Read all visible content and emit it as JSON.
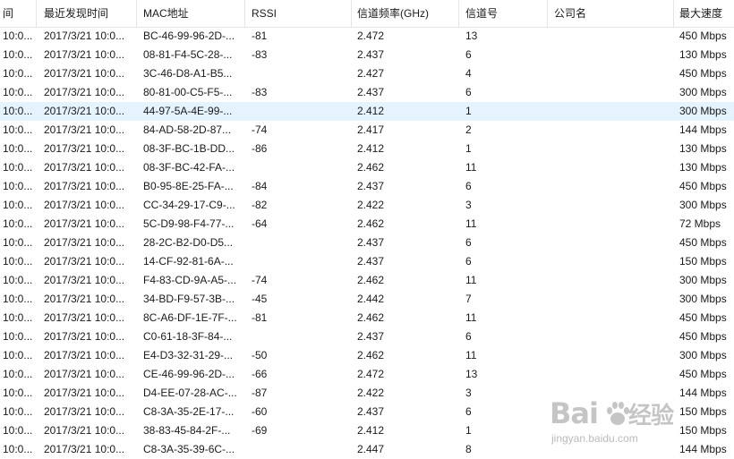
{
  "columns": [
    "间",
    "最近发现时间",
    "MAC地址",
    "RSSI",
    "信道频率(GHz)",
    "信道号",
    "公司名",
    "最大速度"
  ],
  "selected_row": 4,
  "rows": [
    [
      "10:0...",
      "2017/3/21 10:0...",
      "BC-46-99-96-2D-...",
      "-81",
      "2.472",
      "13",
      "",
      "450 Mbps"
    ],
    [
      "10:0...",
      "2017/3/21 10:0...",
      "08-81-F4-5C-28-...",
      "-83",
      "2.437",
      "6",
      "",
      "130 Mbps"
    ],
    [
      "10:0...",
      "2017/3/21 10:0...",
      "3C-46-D8-A1-B5...",
      "",
      "2.427",
      "4",
      "",
      "450 Mbps"
    ],
    [
      "10:0...",
      "2017/3/21 10:0...",
      "80-81-00-C5-F5-...",
      "-83",
      "2.437",
      "6",
      "",
      "300 Mbps"
    ],
    [
      "10:0...",
      "2017/3/21 10:0...",
      "44-97-5A-4E-99-...",
      "",
      "2.412",
      "1",
      "",
      "300 Mbps"
    ],
    [
      "10:0...",
      "2017/3/21 10:0...",
      "84-AD-58-2D-87...",
      "-74",
      "2.417",
      "2",
      "",
      "144 Mbps"
    ],
    [
      "10:0...",
      "2017/3/21 10:0...",
      "08-3F-BC-1B-DD...",
      "-86",
      "2.412",
      "1",
      "",
      "130 Mbps"
    ],
    [
      "10:0...",
      "2017/3/21 10:0...",
      "08-3F-BC-42-FA-...",
      "",
      "2.462",
      "11",
      "",
      "130 Mbps"
    ],
    [
      "10:0...",
      "2017/3/21 10:0...",
      "B0-95-8E-25-FA-...",
      "-84",
      "2.437",
      "6",
      "",
      "450 Mbps"
    ],
    [
      "10:0...",
      "2017/3/21 10:0...",
      "CC-34-29-17-C9-...",
      "-82",
      "2.422",
      "3",
      "",
      "300 Mbps"
    ],
    [
      "10:0...",
      "2017/3/21 10:0...",
      "5C-D9-98-F4-77-...",
      "-64",
      "2.462",
      "11",
      "",
      "72 Mbps"
    ],
    [
      "10:0...",
      "2017/3/21 10:0...",
      "28-2C-B2-D0-D5...",
      "",
      "2.437",
      "6",
      "",
      "450 Mbps"
    ],
    [
      "10:0...",
      "2017/3/21 10:0...",
      "14-CF-92-81-6A-...",
      "",
      "2.437",
      "6",
      "",
      "150 Mbps"
    ],
    [
      "10:0...",
      "2017/3/21 10:0...",
      "F4-83-CD-9A-A5-...",
      "-74",
      "2.462",
      "11",
      "",
      "300 Mbps"
    ],
    [
      "10:0...",
      "2017/3/21 10:0...",
      "34-BD-F9-57-3B-...",
      "-45",
      "2.442",
      "7",
      "",
      "300 Mbps"
    ],
    [
      "10:0...",
      "2017/3/21 10:0...",
      "8C-A6-DF-1E-7F-...",
      "-81",
      "2.462",
      "11",
      "",
      "450 Mbps"
    ],
    [
      "10:0...",
      "2017/3/21 10:0...",
      "C0-61-18-3F-84-...",
      "",
      "2.437",
      "6",
      "",
      "450 Mbps"
    ],
    [
      "10:0...",
      "2017/3/21 10:0...",
      "E4-D3-32-31-29-...",
      "-50",
      "2.462",
      "11",
      "",
      "300 Mbps"
    ],
    [
      "10:0...",
      "2017/3/21 10:0...",
      "CE-46-99-96-2D-...",
      "-66",
      "2.472",
      "13",
      "",
      "450 Mbps"
    ],
    [
      "10:0...",
      "2017/3/21 10:0...",
      "D4-EE-07-28-AC-...",
      "-87",
      "2.422",
      "3",
      "",
      "144 Mbps"
    ],
    [
      "10:0...",
      "2017/3/21 10:0...",
      "C8-3A-35-2E-17-...",
      "-60",
      "2.437",
      "6",
      "",
      "150 Mbps"
    ],
    [
      "10:0...",
      "2017/3/21 10:0...",
      "38-83-45-84-2F-...",
      "-69",
      "2.412",
      "1",
      "",
      "150 Mbps"
    ],
    [
      "10:0...",
      "2017/3/21 10:0...",
      "C8-3A-35-39-6C-...",
      "",
      "2.447",
      "8",
      "",
      "144 Mbps"
    ]
  ],
  "watermark": {
    "logo": "Bai",
    "logo_suffix": "经验",
    "url": "jingyan.baidu.com"
  }
}
